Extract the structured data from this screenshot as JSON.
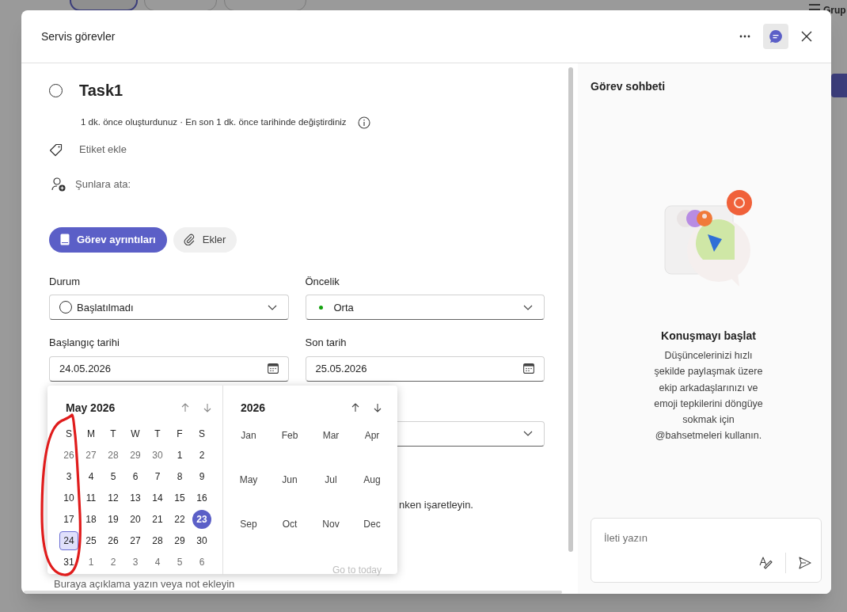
{
  "background": {
    "corner_label": "Grup"
  },
  "dialog": {
    "title": "Servis görevler"
  },
  "task": {
    "title": "Task1",
    "completed": false,
    "meta": "1 dk. önce oluşturdunuz · En son 1 dk. önce tarihinde değiştirdiniz",
    "label_placeholder": "Etiket ekle",
    "assign_label": "Şunlara ata:"
  },
  "tabs": [
    {
      "label": "Görev ayrıntıları",
      "selected": true
    },
    {
      "label": "Ekler",
      "selected": false
    }
  ],
  "fields": [
    {
      "label": "Durum",
      "value": "Başlatılmadı",
      "kind": "status"
    },
    {
      "label": "Öncelik",
      "value": "Orta",
      "kind": "priority",
      "color": "#13a10e"
    },
    {
      "label": "Başlangıç tarihi",
      "value": "24.05.2026",
      "kind": "date"
    },
    {
      "label": "Son tarih",
      "value": "25.05.2026",
      "kind": "date"
    }
  ],
  "hint_fragment": "nken işaretleyin.",
  "notes_placeholder": "Buraya açıklama yazın veya not ekleyin",
  "calendar": {
    "month_title": "May 2026",
    "weekdays": [
      "S",
      "M",
      "T",
      "W",
      "T",
      "F",
      "S"
    ],
    "weeks": [
      [
        {
          "d": "26",
          "outside": true,
          "today": false,
          "selected": false
        },
        {
          "d": "27",
          "outside": true,
          "today": false,
          "selected": false
        },
        {
          "d": "28",
          "outside": true,
          "today": false,
          "selected": false
        },
        {
          "d": "29",
          "outside": true,
          "today": false,
          "selected": false
        },
        {
          "d": "30",
          "outside": true,
          "today": false,
          "selected": false
        },
        {
          "d": "1",
          "outside": false,
          "today": false,
          "selected": false
        },
        {
          "d": "2",
          "outside": false,
          "today": false,
          "selected": false
        }
      ],
      [
        {
          "d": "3",
          "outside": false,
          "today": false,
          "selected": false
        },
        {
          "d": "4",
          "outside": false,
          "today": false,
          "selected": false
        },
        {
          "d": "5",
          "outside": false,
          "today": false,
          "selected": false
        },
        {
          "d": "6",
          "outside": false,
          "today": false,
          "selected": false
        },
        {
          "d": "7",
          "outside": false,
          "today": false,
          "selected": false
        },
        {
          "d": "8",
          "outside": false,
          "today": false,
          "selected": false
        },
        {
          "d": "9",
          "outside": false,
          "today": false,
          "selected": false
        }
      ],
      [
        {
          "d": "10",
          "outside": false,
          "today": false,
          "selected": false
        },
        {
          "d": "11",
          "outside": false,
          "today": false,
          "selected": false
        },
        {
          "d": "12",
          "outside": false,
          "today": false,
          "selected": false
        },
        {
          "d": "13",
          "outside": false,
          "today": false,
          "selected": false
        },
        {
          "d": "14",
          "outside": false,
          "today": false,
          "selected": false
        },
        {
          "d": "15",
          "outside": false,
          "today": false,
          "selected": false
        },
        {
          "d": "16",
          "outside": false,
          "today": false,
          "selected": false
        }
      ],
      [
        {
          "d": "17",
          "outside": false,
          "today": false,
          "selected": false
        },
        {
          "d": "18",
          "outside": false,
          "today": false,
          "selected": false
        },
        {
          "d": "19",
          "outside": false,
          "today": false,
          "selected": false
        },
        {
          "d": "20",
          "outside": false,
          "today": false,
          "selected": false
        },
        {
          "d": "21",
          "outside": false,
          "today": false,
          "selected": false
        },
        {
          "d": "22",
          "outside": false,
          "today": false,
          "selected": false
        },
        {
          "d": "23",
          "outside": false,
          "today": true,
          "selected": false
        }
      ],
      [
        {
          "d": "24",
          "outside": false,
          "today": false,
          "selected": true
        },
        {
          "d": "25",
          "outside": false,
          "today": false,
          "selected": false
        },
        {
          "d": "26",
          "outside": false,
          "today": false,
          "selected": false
        },
        {
          "d": "27",
          "outside": false,
          "today": false,
          "selected": false
        },
        {
          "d": "28",
          "outside": false,
          "today": false,
          "selected": false
        },
        {
          "d": "29",
          "outside": false,
          "today": false,
          "selected": false
        },
        {
          "d": "30",
          "outside": false,
          "today": false,
          "selected": false
        }
      ],
      [
        {
          "d": "31",
          "outside": false,
          "today": false,
          "selected": false
        },
        {
          "d": "1",
          "outside": true,
          "today": false,
          "selected": false
        },
        {
          "d": "2",
          "outside": true,
          "today": false,
          "selected": false
        },
        {
          "d": "3",
          "outside": true,
          "today": false,
          "selected": false
        },
        {
          "d": "4",
          "outside": true,
          "today": false,
          "selected": false
        },
        {
          "d": "5",
          "outside": true,
          "today": false,
          "selected": false
        },
        {
          "d": "6",
          "outside": true,
          "today": false,
          "selected": false
        }
      ]
    ],
    "year_title": "2026",
    "months": [
      "Jan",
      "Feb",
      "Mar",
      "Apr",
      "May",
      "Jun",
      "Jul",
      "Aug",
      "Sep",
      "Oct",
      "Nov",
      "Dec"
    ],
    "go_to_today": "Go to today"
  },
  "chat": {
    "title": "Görev sohbeti",
    "heading": "Konuşmayı başlat",
    "body": "Düşüncelerinizi hızlı şekilde paylaşmak üzere ekip arkadaşlarınızı ve emoji tepkilerini döngüye sokmak için @bahsetmeleri kullanın.",
    "input_placeholder": "İleti yazın"
  }
}
